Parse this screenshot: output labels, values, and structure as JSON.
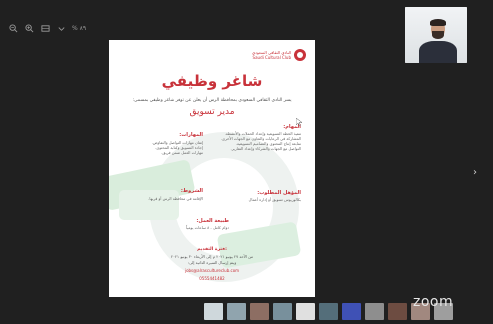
{
  "toolbar": {
    "items": [
      "zoom-out-icon",
      "zoom-in-icon",
      "fit-page-icon",
      "chevron-down-icon"
    ],
    "zoom_level": "% ٨٩"
  },
  "flyer": {
    "logo_text_line1": "النادي الثقافي السعودي",
    "logo_text_line2": "Saudi Cultural Club",
    "title": "شاغر وظيفي",
    "intro": "يسر النادي الثقافي السعودي بمحافظة الرس أن يعلن عن توفر شاغر وظيفي بمسمى:",
    "position": "مدير تسويق",
    "sections": {
      "tasks": {
        "heading": "المهام:",
        "lines": [
          "تنفيذ الخطة التسويقية وإعداد الحملات والأنشطة.",
          "المشاركة في الرعايات والتعاون مع الجهات الأخرى.",
          "متابعة إنتاج المحتوى والتصاميم التسويقية.",
          "التواصل مع الجهات والشركاء وإعداد التقارير."
        ]
      },
      "skills": {
        "heading": "المهارات:",
        "lines": [
          "إتقان مهارات التواصل والتفاوض.",
          "إجادة التسويق وكتابة المحتوى.",
          "مهارات العمل ضمن فريق."
        ]
      },
      "qualification": {
        "heading": "المؤهل المطلوب:",
        "lines": [
          "بكالوريوس تسويق أو إدارة أعمال"
        ]
      },
      "conditions": {
        "heading": "الشروط:",
        "lines": [
          "الإقامة في محافظة الرس أو قربها."
        ]
      },
      "work_type": {
        "heading": "طبيعة العمل:",
        "lines": [
          "دوام كامل - ٨ ساعات يومياً"
        ]
      }
    },
    "deadline_heading": "فترة التقديم:",
    "deadline_line1": "من الأحد ٢٧ يونيو ٢٠٢١ م إلى الأربعاء ٣٠ يونيو ٢٠٢١",
    "deadline_line2": "ويتم إرسال السيرة الذاتية إلى:",
    "email": "jobs@alrascultureclub.com",
    "phone": "0555441482"
  },
  "brand": "zoom",
  "colors": {
    "accent": "#c8323a",
    "background": "#202020"
  },
  "thumbnails": [
    {
      "color": "#cfd8dc"
    },
    {
      "color": "#90a4ae"
    },
    {
      "color": "#8d6e63"
    },
    {
      "color": "#78909c"
    },
    {
      "color": "#e0e0e0"
    },
    {
      "color": "#546e7a"
    },
    {
      "color": "#3f51b5"
    },
    {
      "color": "#8e8e8e"
    },
    {
      "color": "#6d4c41"
    },
    {
      "color": "#a1887f"
    },
    {
      "color": "#9e9e9e"
    }
  ]
}
